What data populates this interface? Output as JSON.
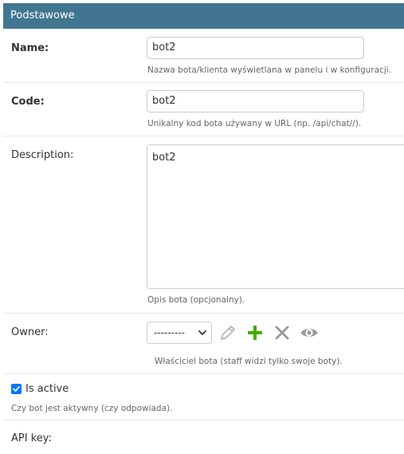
{
  "fieldset": {
    "title": "Podstawowe"
  },
  "fields": {
    "name": {
      "label": "Name:",
      "value": "bot2",
      "help": "Nazwa bota/klienta wyświetlana w panelu i w konfiguracji."
    },
    "code": {
      "label": "Code:",
      "value": "bot2",
      "help": "Unikalny kod bota używany w URL (np. /api/chat//)."
    },
    "description": {
      "label": "Description:",
      "value": "bot2",
      "help": "Opis bota (opcjonalny)."
    },
    "owner": {
      "label": "Owner:",
      "selected": "---------",
      "help": "Właściciel bota (staff widzi tylko swoje boty).",
      "icons": [
        "pencil-icon",
        "plus-icon",
        "close-icon",
        "eye-icon"
      ]
    },
    "is_active": {
      "label": "Is active",
      "checked": true,
      "help": "Czy bot jest aktywny (czy odpowiada)."
    },
    "api_key": {
      "label": "API key:"
    }
  },
  "colors": {
    "header": "#417690",
    "add_green": "#44aa00",
    "icon_gray": "#999999",
    "checkbox": "#0075ff"
  }
}
